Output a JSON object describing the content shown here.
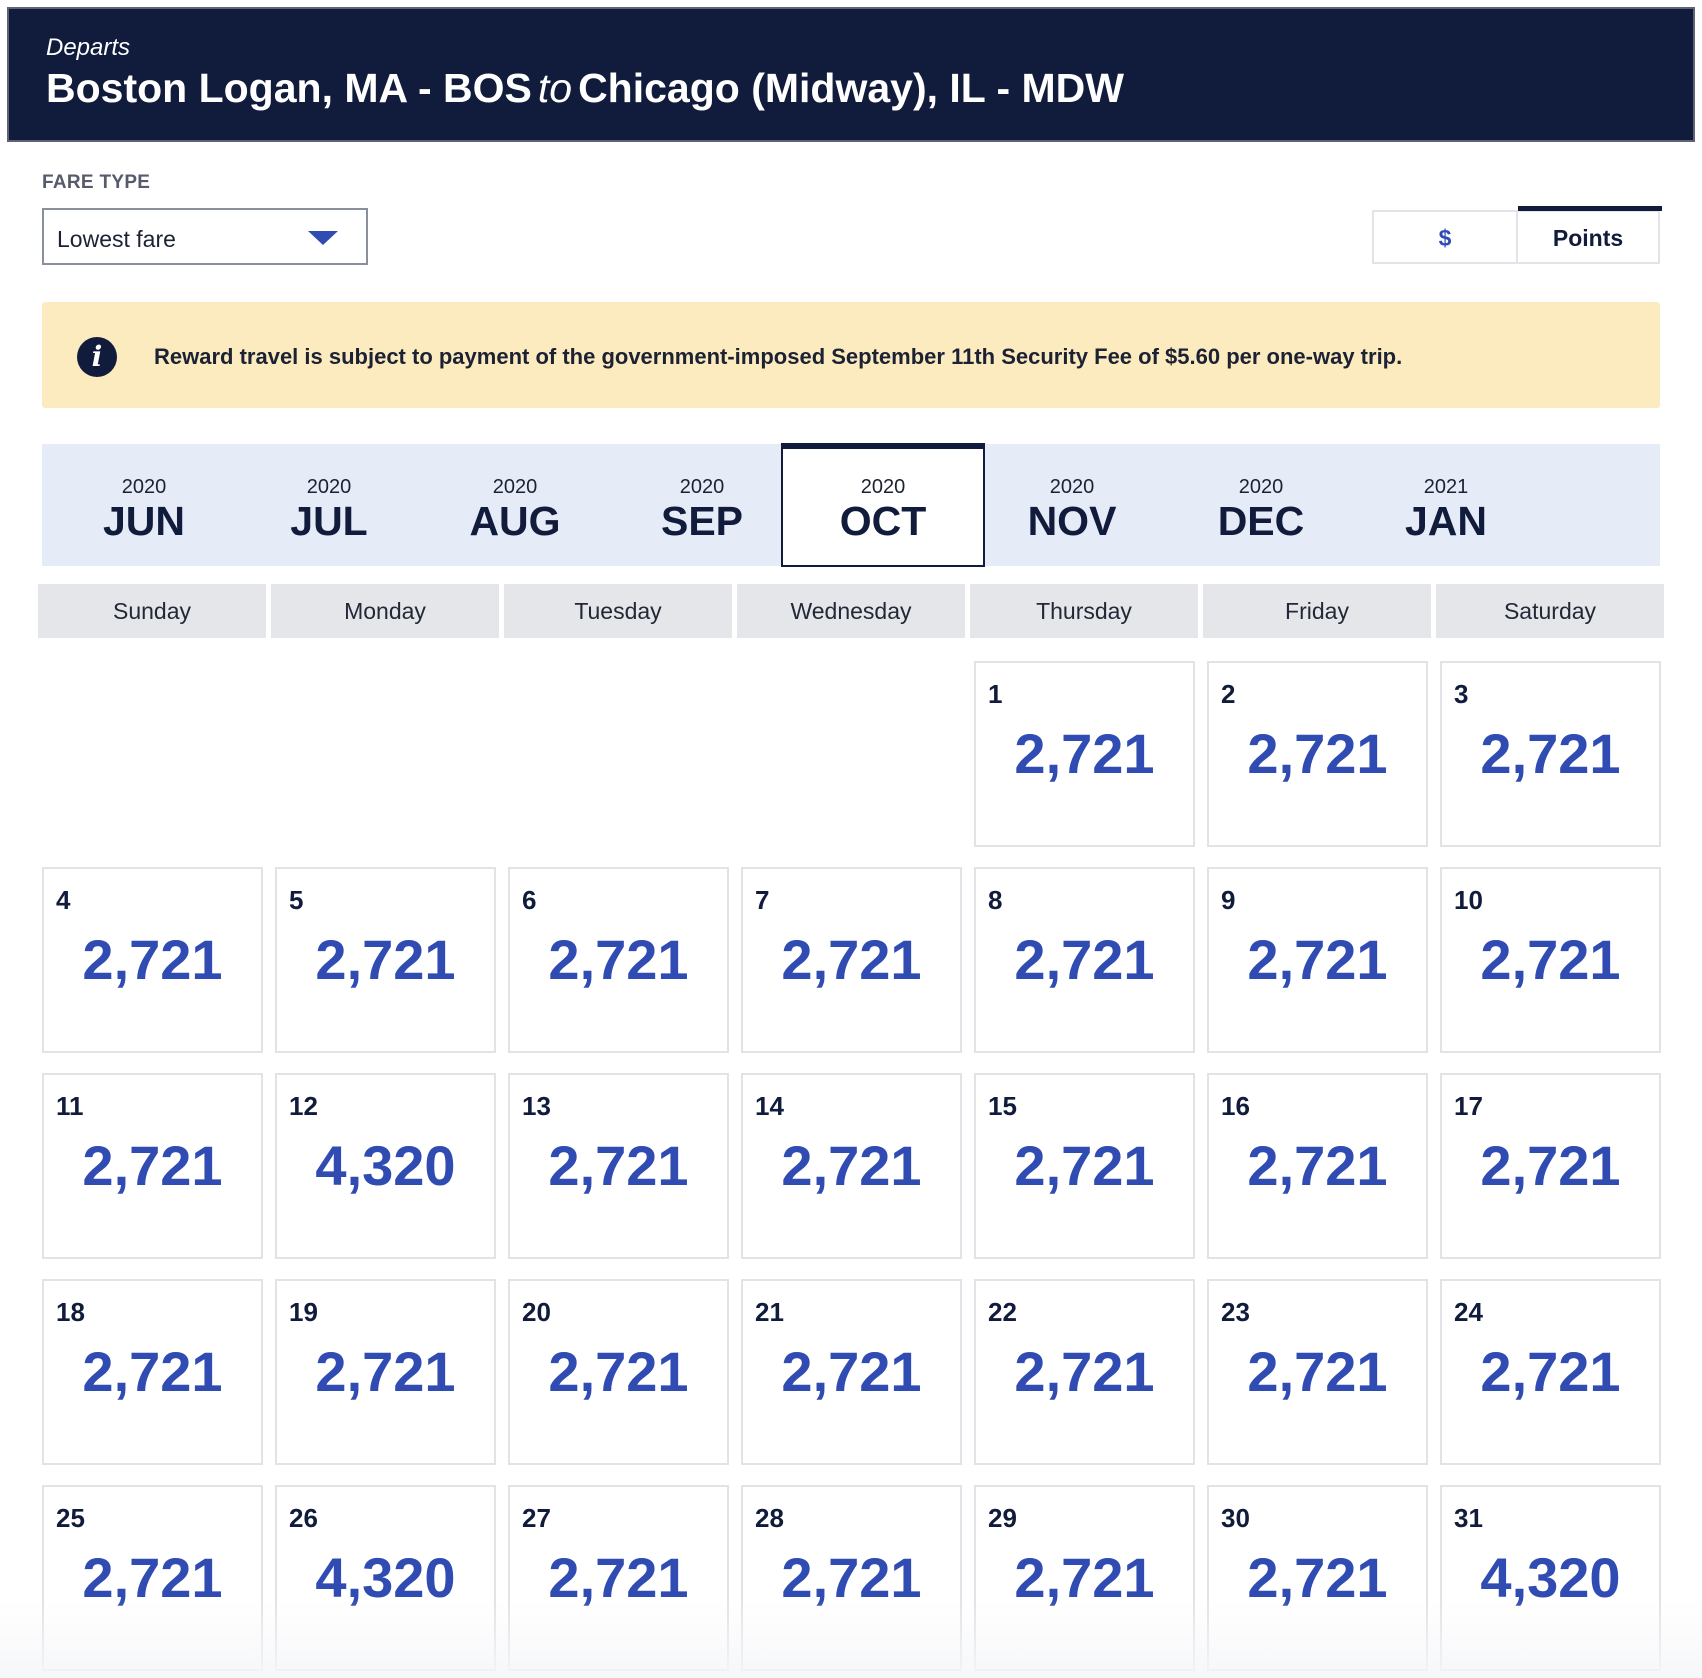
{
  "header": {
    "departs": "Departs",
    "origin": "Boston Logan, MA - BOS",
    "to": "to",
    "destination": "Chicago (Midway), IL - MDW"
  },
  "fare_type": {
    "label": "FARE TYPE",
    "selected": "Lowest fare"
  },
  "currency_toggle": {
    "dollar_label": "$",
    "points_label": "Points",
    "active": "Points"
  },
  "notice": {
    "icon": "info-icon",
    "message": "Reward travel is subject to payment of the government-imposed September 11th Security Fee of $5.60 per one-way trip."
  },
  "months": [
    {
      "year": "2020",
      "month": "JUN"
    },
    {
      "year": "2020",
      "month": "JUL"
    },
    {
      "year": "2020",
      "month": "AUG"
    },
    {
      "year": "2020",
      "month": "SEP"
    },
    {
      "year": "2020",
      "month": "OCT",
      "active": true
    },
    {
      "year": "2020",
      "month": "NOV"
    },
    {
      "year": "2020",
      "month": "DEC"
    },
    {
      "year": "2021",
      "month": "JAN"
    }
  ],
  "weekdays": [
    "Sunday",
    "Monday",
    "Tuesday",
    "Wednesday",
    "Thursday",
    "Friday",
    "Saturday"
  ],
  "calendar": {
    "first_weekday_index": 4,
    "days": [
      {
        "day": "1",
        "price": "2,721"
      },
      {
        "day": "2",
        "price": "2,721"
      },
      {
        "day": "3",
        "price": "2,721"
      },
      {
        "day": "4",
        "price": "2,721"
      },
      {
        "day": "5",
        "price": "2,721"
      },
      {
        "day": "6",
        "price": "2,721"
      },
      {
        "day": "7",
        "price": "2,721"
      },
      {
        "day": "8",
        "price": "2,721"
      },
      {
        "day": "9",
        "price": "2,721"
      },
      {
        "day": "10",
        "price": "2,721"
      },
      {
        "day": "11",
        "price": "2,721"
      },
      {
        "day": "12",
        "price": "4,320"
      },
      {
        "day": "13",
        "price": "2,721"
      },
      {
        "day": "14",
        "price": "2,721"
      },
      {
        "day": "15",
        "price": "2,721"
      },
      {
        "day": "16",
        "price": "2,721"
      },
      {
        "day": "17",
        "price": "2,721"
      },
      {
        "day": "18",
        "price": "2,721"
      },
      {
        "day": "19",
        "price": "2,721"
      },
      {
        "day": "20",
        "price": "2,721"
      },
      {
        "day": "21",
        "price": "2,721"
      },
      {
        "day": "22",
        "price": "2,721"
      },
      {
        "day": "23",
        "price": "2,721"
      },
      {
        "day": "24",
        "price": "2,721"
      },
      {
        "day": "25",
        "price": "2,721"
      },
      {
        "day": "26",
        "price": "4,320"
      },
      {
        "day": "27",
        "price": "2,721"
      },
      {
        "day": "28",
        "price": "2,721"
      },
      {
        "day": "29",
        "price": "2,721"
      },
      {
        "day": "30",
        "price": "2,721"
      },
      {
        "day": "31",
        "price": "4,320"
      }
    ]
  },
  "colors": {
    "navy": "#111b3c",
    "price_blue": "#304cb2",
    "notice_bg": "#fdebc0",
    "month_strip_bg": "#e6ebf8"
  }
}
